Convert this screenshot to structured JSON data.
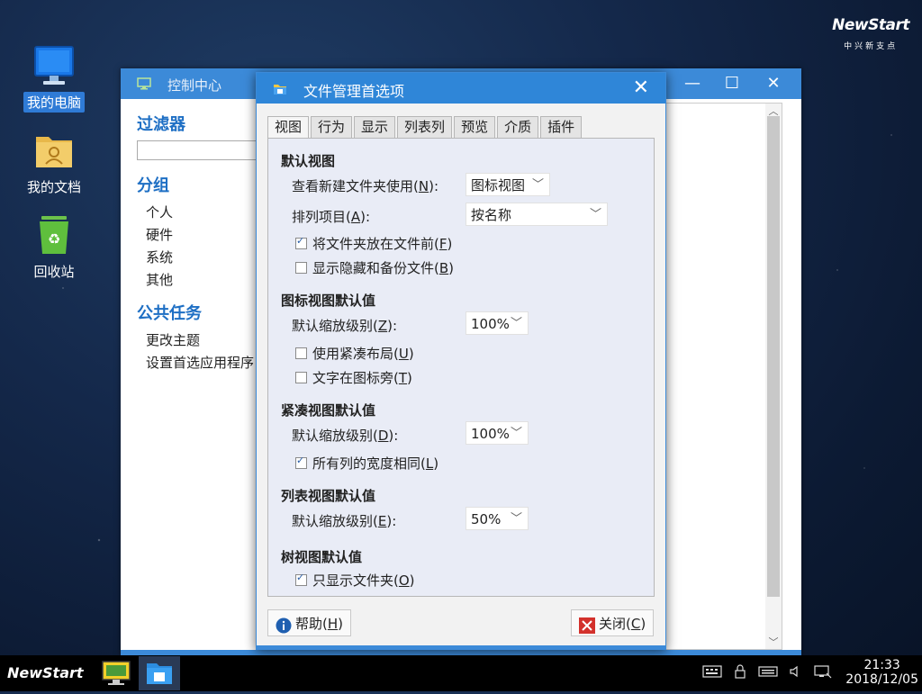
{
  "brand": {
    "logo": "NewStart",
    "subtitle": "中兴新支点"
  },
  "desktop": {
    "icons": [
      {
        "label": "我的电脑",
        "icon": "computer-icon"
      },
      {
        "label": "我的文档",
        "icon": "documents-folder-icon"
      },
      {
        "label": "回收站",
        "icon": "recycle-bin-icon"
      }
    ]
  },
  "control_center": {
    "title": "控制中心",
    "filter_title": "过滤器",
    "groups_title": "分组",
    "groups": [
      "个人",
      "硬件",
      "系统",
      "其他"
    ],
    "tasks_title": "公共任务",
    "tasks": [
      "更改主题",
      "设置首选应用程序"
    ],
    "buttons": {
      "minimize": "—",
      "maximize": "☐",
      "close": "✕"
    }
  },
  "dialog": {
    "title": "文件管理首选项",
    "close": "✕",
    "tabs": [
      "视图",
      "行为",
      "显示",
      "列表列",
      "预览",
      "介质",
      "插件"
    ],
    "active_tab": "视图",
    "default_view": {
      "title": "默认视图",
      "new_folder_label": "查看新建文件夹使用(",
      "new_folder_key": "N",
      "new_folder_suffix": "):",
      "new_folder_value": "图标视图",
      "arrange_label": "排列项目(",
      "arrange_key": "A",
      "arrange_suffix": "):",
      "arrange_value": "按名称",
      "folders_first_label": "将文件夹放在文件前(",
      "folders_first_key": "F",
      "folders_first_suffix": ")",
      "folders_first_checked": true,
      "show_hidden_label": "显示隐藏和备份文件(",
      "show_hidden_key": "B",
      "show_hidden_suffix": ")",
      "show_hidden_checked": false
    },
    "icon_view": {
      "title": "图标视图默认值",
      "zoom_label": "默认缩放级别(",
      "zoom_key": "Z",
      "zoom_suffix": "):",
      "zoom_value": "100%",
      "compact_label": "使用紧凑布局(",
      "compact_key": "U",
      "compact_suffix": ")",
      "compact_checked": false,
      "text_beside_label": "文字在图标旁(",
      "text_beside_key": "T",
      "text_beside_suffix": ")",
      "text_beside_checked": false
    },
    "compact_view": {
      "title": "紧凑视图默认值",
      "zoom_label": "默认缩放级别(",
      "zoom_key": "D",
      "zoom_suffix": "):",
      "zoom_value": "100%",
      "same_width_label": "所有列的宽度相同(",
      "same_width_key": "L",
      "same_width_suffix": ")",
      "same_width_checked": true
    },
    "list_view": {
      "title": "列表视图默认值",
      "zoom_label": "默认缩放级别(",
      "zoom_key": "E",
      "zoom_suffix": "):",
      "zoom_value": "50%"
    },
    "tree_view": {
      "title": "树视图默认值",
      "folders_only_label": "只显示文件夹(",
      "folders_only_key": "O",
      "folders_only_suffix": ")",
      "folders_only_checked": true
    },
    "help_button": {
      "label": "帮助(",
      "key": "H",
      "suffix": ")"
    },
    "close_button": {
      "label": "关闭(",
      "key": "C",
      "suffix": ")"
    }
  },
  "taskbar": {
    "start_label": "NewStart",
    "time": "21:33",
    "date": "2018/12/05"
  }
}
